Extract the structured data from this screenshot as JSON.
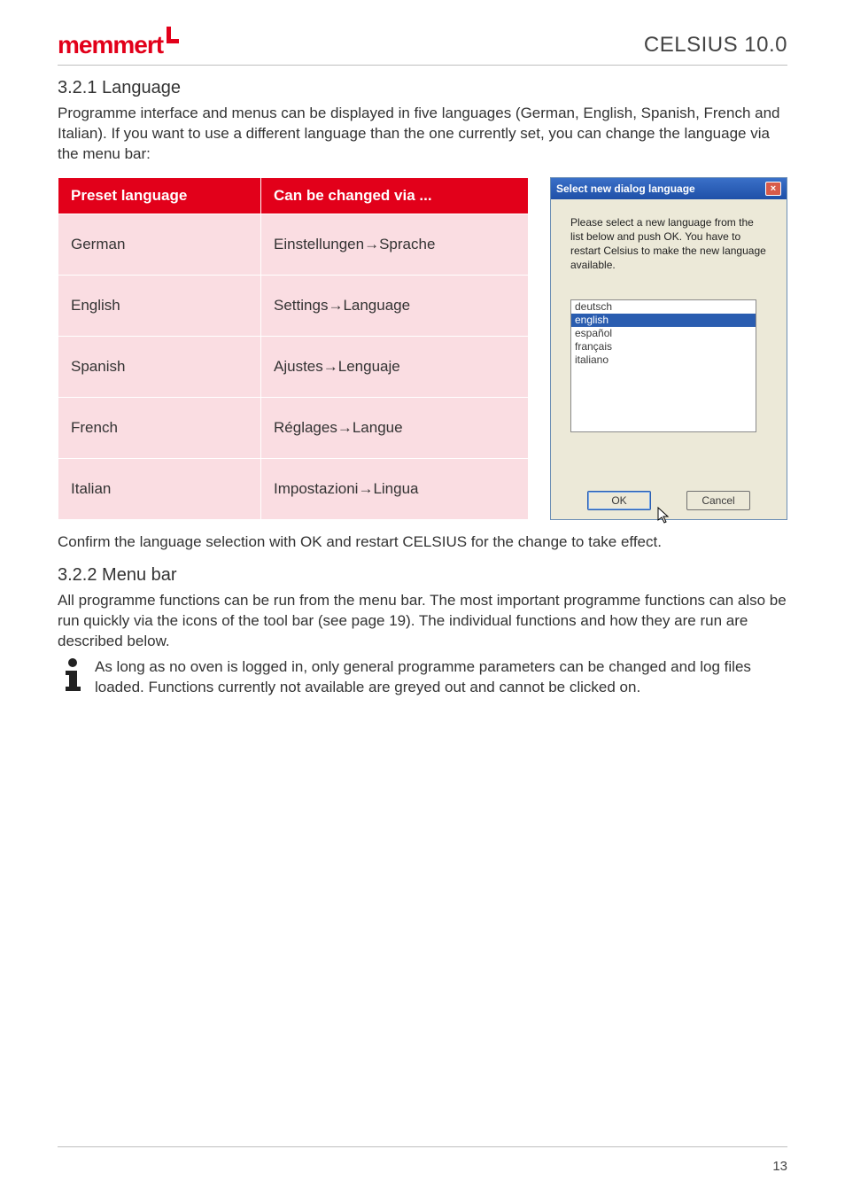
{
  "header": {
    "logo_text": "memmert",
    "doc_title": "CELSIUS 10.0"
  },
  "section1": {
    "heading": "3.2.1  Language",
    "intro": "Programme interface and menus can be displayed in five languages (German, English, Spanish, French and Italian). If you want to use a different language than the one currently set, you can change the language via the menu bar:",
    "confirm": "Confirm the language selection with OK and restart CELSIUS for the change to take effect."
  },
  "table": {
    "headers": [
      "Preset language",
      "Can be changed via ..."
    ],
    "rows": [
      {
        "lang": "German",
        "path": "Einstellungen→Sprache"
      },
      {
        "lang": "English",
        "path": "Settings→Language"
      },
      {
        "lang": "Spanish",
        "path": "Ajustes→Lenguaje"
      },
      {
        "lang": "French",
        "path": "Réglages→Langue"
      },
      {
        "lang": "Italian",
        "path": "Impostazioni→Lingua"
      }
    ]
  },
  "dialog": {
    "title": "Select new dialog language",
    "instruction": "Please select a new language from the list below and push OK. You have to restart Celsius to make the new language available.",
    "options": [
      "deutsch",
      "english",
      "español",
      "français",
      "italiano"
    ],
    "selected_index": 1,
    "ok": "OK",
    "cancel": "Cancel"
  },
  "section2": {
    "heading": "3.2.2  Menu bar",
    "body": "All programme functions can be run from the menu bar. The most important programme functions can also be run quickly via the icons of the tool bar (see page 19). The individual functions and how they are run are described below.",
    "note": "As long as no oven is logged in, only general programme parameters can be changed and log files loaded. Functions currently not available are greyed out and cannot be clicked on."
  },
  "page_number": "13"
}
